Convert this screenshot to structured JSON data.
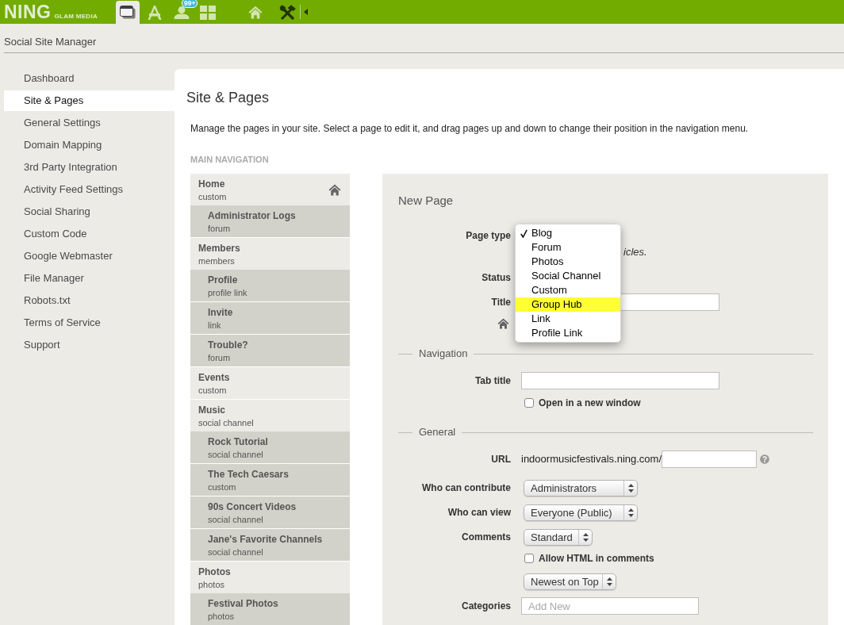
{
  "top_bar": {
    "logo": "NING",
    "logo_subtitle": "GLAM MEDIA",
    "toolbar": [
      {
        "kind": "window",
        "selected": true
      },
      {
        "kind": "apps",
        "selected": false
      },
      {
        "kind": "members",
        "selected": false,
        "badge": "99+"
      },
      {
        "kind": "grid",
        "selected": false
      },
      {
        "kind": "home",
        "selected": false
      },
      {
        "kind": "tools",
        "selected": false
      }
    ]
  },
  "header": {
    "title": "Social Site Manager"
  },
  "sidebar": {
    "items": [
      {
        "label": "Dashboard",
        "selected": false
      },
      {
        "label": "Site & Pages",
        "selected": true
      },
      {
        "label": "General Settings",
        "selected": false
      },
      {
        "label": "Domain Mapping",
        "selected": false
      },
      {
        "label": "3rd Party Integration",
        "selected": false
      },
      {
        "label": "Activity Feed Settings",
        "selected": false
      },
      {
        "label": "Social Sharing",
        "selected": false
      },
      {
        "label": "Custom Code",
        "selected": false
      },
      {
        "label": "Google Webmaster",
        "selected": false
      },
      {
        "label": "File Manager",
        "selected": false
      },
      {
        "label": "Robots.txt",
        "selected": false
      },
      {
        "label": "Terms of Service",
        "selected": false
      },
      {
        "label": "Support",
        "selected": false
      }
    ]
  },
  "main": {
    "title": "Site & Pages",
    "description": "Manage the pages in your site. Select a page to edit it, and drag pages up and down to change their position in the navigation menu.",
    "navigation": {
      "heading": "MAIN NAVIGATION",
      "pages": [
        {
          "title": "Home",
          "type": "custom",
          "homepage": true,
          "children": [
            {
              "title": "Administrator Logs",
              "type": "forum",
              "homepage": false
            }
          ]
        },
        {
          "title": "Members",
          "type": "members",
          "homepage": false,
          "children": [
            {
              "title": "Profile",
              "type": "profile link",
              "homepage": false
            },
            {
              "title": "Invite",
              "type": "link",
              "homepage": false
            },
            {
              "title": "Trouble?",
              "type": "forum",
              "homepage": false
            }
          ]
        },
        {
          "title": "Events",
          "type": "custom",
          "homepage": false
        },
        {
          "title": "Music",
          "type": "social channel",
          "homepage": false,
          "children": [
            {
              "title": "Rock Tutorial",
              "type": "social channel",
              "homepage": false
            },
            {
              "title": "The Tech Caesars",
              "type": "custom",
              "homepage": false
            },
            {
              "title": "90s Concert Videos",
              "type": "social channel",
              "homepage": false
            },
            {
              "title": "Jane's Favorite Channels",
              "type": "social channel",
              "homepage": false
            }
          ]
        },
        {
          "title": "Photos",
          "type": "photos",
          "homepage": false,
          "children": [
            {
              "title": "Festival Photos",
              "type": "photos",
              "homepage": false
            }
          ]
        }
      ]
    },
    "new_page_form": {
      "title": "New Page",
      "page_type": {
        "label": "Page type",
        "expanded": true,
        "options": [
          {
            "label": "Blog",
            "checked": true,
            "highlighted": false
          },
          {
            "label": "Forum",
            "checked": false,
            "highlighted": false
          },
          {
            "label": "Photos",
            "checked": false,
            "highlighted": false
          },
          {
            "label": "Social Channel",
            "checked": false,
            "highlighted": false
          },
          {
            "label": "Custom",
            "checked": false,
            "highlighted": false
          },
          {
            "label": "Group Hub",
            "checked": false,
            "highlighted": true
          },
          {
            "label": "Link",
            "checked": false,
            "highlighted": false
          },
          {
            "label": "Profile Link",
            "checked": false,
            "highlighted": false
          }
        ]
      },
      "page_type_hint": "icles.",
      "status": {
        "label": "Status"
      },
      "title_field": {
        "label": "Title"
      },
      "navigation": {
        "legend": "Navigation",
        "tab_title": {
          "label": "Tab title"
        },
        "open_in_new_window": {
          "label": "Open in a new window",
          "checked": false
        }
      },
      "general": {
        "legend": "General",
        "url": {
          "label": "URL",
          "prefix": "indoormusicfestivals.ning.com/"
        },
        "who_can_contribute": {
          "label": "Who can contribute",
          "value": "Administrators"
        },
        "who_can_view": {
          "label": "Who can view",
          "value": "Everyone (Public)"
        },
        "comments": {
          "label": "Comments",
          "value": "Standard"
        },
        "allow_html": {
          "label": "Allow HTML in comments",
          "checked": false
        },
        "comment_order": {
          "value": "Newest on Top"
        },
        "categories": {
          "label": "Categories",
          "placeholder": "Add New"
        }
      }
    }
  }
}
